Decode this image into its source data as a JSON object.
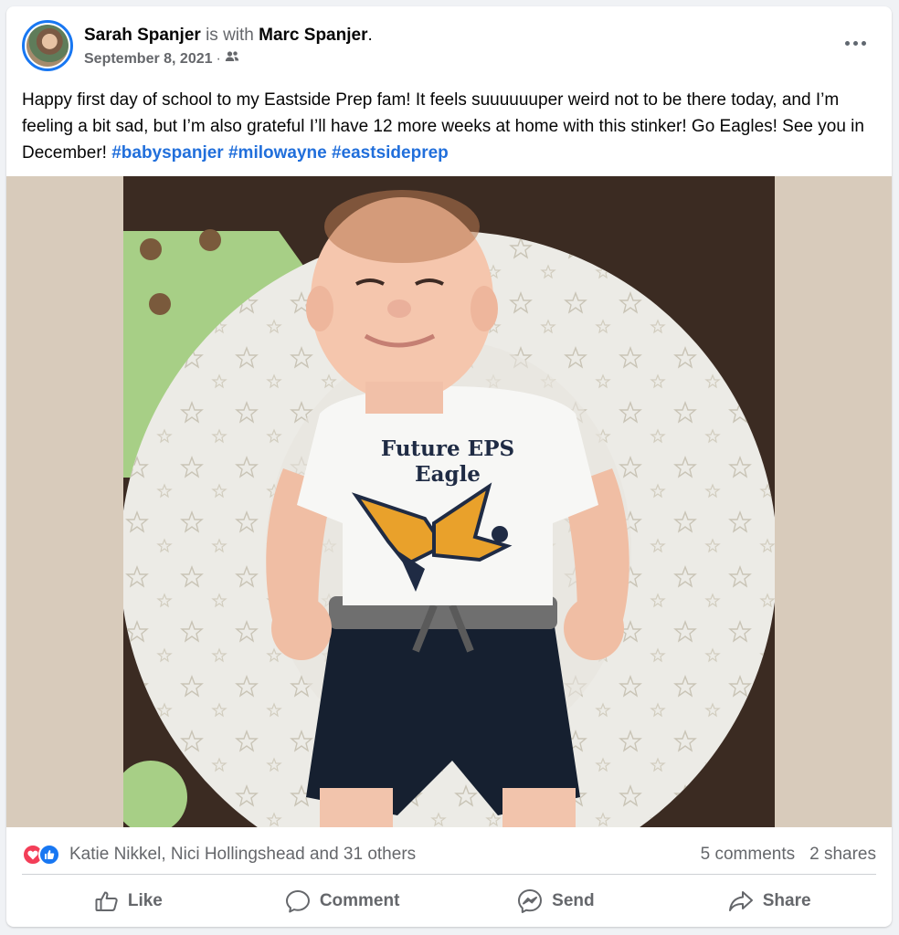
{
  "post": {
    "author": "Sarah Spanjer",
    "with_text": "is with",
    "tagged": "Marc Spanjer",
    "period": ".",
    "date": "September 8, 2021",
    "separator": "·",
    "audience_icon": "friends-icon",
    "text_main": "Happy first day of school to my Eastside Prep fam! It feels suuuuuuper weird not to be there today, and I’m feeling a bit sad, but I’m also grateful I’ll have 12 more weeks at home with this stinker! Go Eagles! See you in December! ",
    "hashtags": [
      "#babyspanjer",
      "#milowayne",
      "#eastsideprep"
    ],
    "photo": {
      "shirt_line1": "Future EPS",
      "shirt_line2": "Eagle"
    }
  },
  "reactions": {
    "icons": [
      "love-icon",
      "like-icon"
    ],
    "summary": "Katie Nikkel, Nici Hollingshead and 31 others",
    "comments": "5 comments",
    "shares": "2 shares"
  },
  "actions": {
    "like": "Like",
    "comment": "Comment",
    "send": "Send",
    "share": "Share"
  },
  "colors": {
    "accent": "#1877f2",
    "hashtag": "#216fdb",
    "love": "#f33e58",
    "secondary_text": "#65676b"
  }
}
